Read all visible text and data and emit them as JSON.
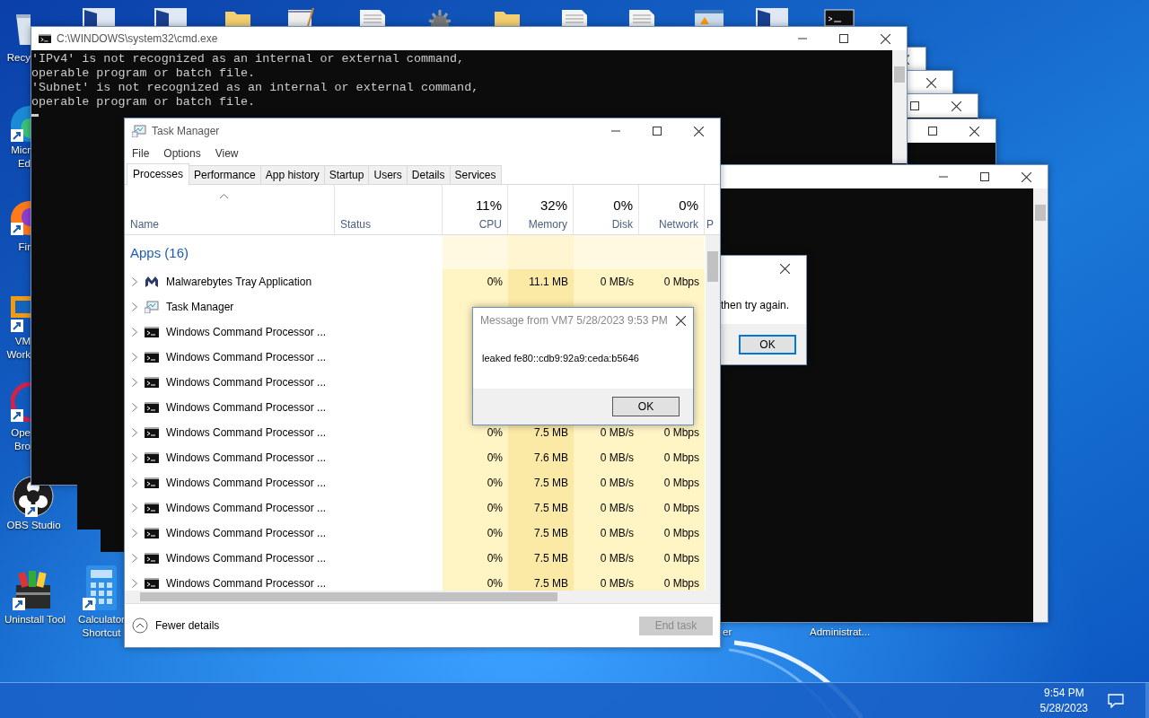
{
  "desktop_icons": [
    {
      "kind": "recycle",
      "lines": [
        "Recy"
      ]
    },
    {
      "kind": "edge",
      "lines": [
        "Micr",
        "Ed"
      ]
    },
    {
      "kind": "firefox",
      "lines": [
        "Fir"
      ]
    },
    {
      "kind": "vmware",
      "lines": [
        "VM",
        "Work"
      ]
    },
    {
      "kind": "opera",
      "lines": [
        "Ope",
        "Bro"
      ]
    },
    {
      "kind": "obs",
      "lines": [
        "OBS Studio"
      ]
    },
    {
      "kind": "uninstall",
      "lines": [
        "Uninstall Tool"
      ]
    },
    {
      "kind": "calculator",
      "lines": [
        "Calculator",
        "Shortcut"
      ]
    }
  ],
  "desktop_labels": [
    "er",
    "Administrat..."
  ],
  "cmd_window": {
    "title": "C:\\WINDOWS\\system32\\cmd.exe",
    "lines": [
      "'IPv4' is not recognized as an internal or external command,",
      "operable program or batch file.",
      "'Subnet' is not recognized as an internal or external command,",
      "operable program or batch file."
    ]
  },
  "back_dialog": {
    "text": "then try again.",
    "button": {
      "label": "OK",
      "focused": true
    }
  },
  "task_manager": {
    "title": "Task Manager",
    "menu": [
      "File",
      "Options",
      "View"
    ],
    "tabs": [
      {
        "label": "Processes",
        "selected": true
      },
      {
        "label": "Performance",
        "selected": false
      },
      {
        "label": "App history",
        "selected": false
      },
      {
        "label": "Startup",
        "selected": false
      },
      {
        "label": "Users",
        "selected": false
      },
      {
        "label": "Details",
        "selected": false
      },
      {
        "label": "Services",
        "selected": false
      }
    ],
    "columns": [
      {
        "label": "Name"
      },
      {
        "label": "Status"
      },
      {
        "percent": "11%",
        "label": "CPU"
      },
      {
        "percent": "32%",
        "label": "Memory"
      },
      {
        "percent": "0%",
        "label": "Disk"
      },
      {
        "percent": "0%",
        "label": "Network"
      },
      {
        "label": "P"
      }
    ],
    "group": "Apps (16)",
    "rows": [
      {
        "kind": "malwarebytes",
        "name": "Malwarebytes Tray Application",
        "expanded": false,
        "cpu": "0%",
        "memory": "11.1 MB",
        "disk": "0 MB/s",
        "network": "0 Mbps"
      },
      {
        "kind": "taskmgr",
        "name": "Task Manager",
        "expanded": false
      },
      {
        "kind": "cmd",
        "name": "Windows Command Processor ...",
        "expanded": false
      },
      {
        "kind": "cmd",
        "name": "Windows Command Processor ...",
        "expanded": false
      },
      {
        "kind": "cmd",
        "name": "Windows Command Processor ...",
        "expanded": false
      },
      {
        "kind": "cmd",
        "name": "Windows Command Processor ...",
        "expanded": false
      },
      {
        "kind": "cmd",
        "name": "Windows Command Processor ...",
        "expanded": false,
        "cpu": "0%",
        "memory": "7.5 MB",
        "disk": "0 MB/s",
        "network": "0 Mbps"
      },
      {
        "kind": "cmd",
        "name": "Windows Command Processor ...",
        "expanded": false,
        "cpu": "0%",
        "memory": "7.6 MB",
        "disk": "0 MB/s",
        "network": "0 Mbps"
      },
      {
        "kind": "cmd",
        "name": "Windows Command Processor ...",
        "expanded": false,
        "cpu": "0%",
        "memory": "7.5 MB",
        "disk": "0 MB/s",
        "network": "0 Mbps"
      },
      {
        "kind": "cmd",
        "name": "Windows Command Processor ...",
        "expanded": false,
        "cpu": "0%",
        "memory": "7.5 MB",
        "disk": "0 MB/s",
        "network": "0 Mbps"
      },
      {
        "kind": "cmd",
        "name": "Windows Command Processor ...",
        "expanded": false,
        "cpu": "0%",
        "memory": "7.5 MB",
        "disk": "0 MB/s",
        "network": "0 Mbps"
      },
      {
        "kind": "cmd",
        "name": "Windows Command Processor ...",
        "expanded": false,
        "cpu": "0%",
        "memory": "7.5 MB",
        "disk": "0 MB/s",
        "network": "0 Mbps"
      },
      {
        "kind": "cmd",
        "name": "Windows Command Processor ...",
        "expanded": false,
        "cpu": "0%",
        "memory": "7.5 MB",
        "disk": "0 MB/s",
        "network": "0 Mbps"
      }
    ],
    "fewer_details": "Fewer details",
    "end_task": {
      "label": "End task",
      "disabled": true
    }
  },
  "message_box": {
    "title": "Message from VM7 5/28/2023 9:53 PM",
    "text": "leaked fe80::cdb9:92a9:ceda:b5646",
    "button": "OK"
  },
  "taskbar": {
    "time": "9:54 PM",
    "date": "5/28/2023"
  }
}
